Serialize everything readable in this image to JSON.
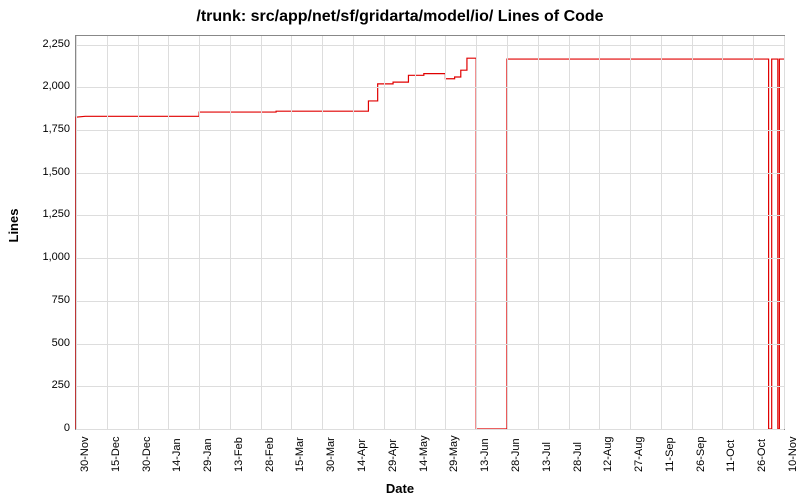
{
  "chart_data": {
    "type": "line",
    "title": "/trunk: src/app/net/sf/gridarta/model/io/ Lines of Code",
    "xlabel": "Date",
    "ylabel": "Lines",
    "ylim": [
      0,
      2300
    ],
    "yticks": [
      0,
      250,
      500,
      750,
      1000,
      1250,
      1500,
      1750,
      2000,
      2250
    ],
    "ytick_labels": [
      "0",
      "250",
      "500",
      "750",
      "1,000",
      "1,250",
      "1,500",
      "1,750",
      "2,000",
      "2,250"
    ],
    "xticks": [
      "30-Nov",
      "15-Dec",
      "30-Dec",
      "14-Jan",
      "29-Jan",
      "13-Feb",
      "28-Feb",
      "15-Mar",
      "30-Mar",
      "14-Apr",
      "29-Apr",
      "14-May",
      "29-May",
      "13-Jun",
      "28-Jun",
      "13-Jul",
      "28-Jul",
      "12-Aug",
      "27-Aug",
      "11-Sep",
      "26-Sep",
      "11-Oct",
      "26-Oct",
      "10-Nov"
    ],
    "x": [
      0,
      1,
      2,
      3,
      4,
      5,
      6,
      7,
      8,
      9,
      10,
      11,
      12,
      13,
      14,
      15,
      16,
      17,
      18,
      19,
      20,
      21,
      22,
      23
    ],
    "series": [
      {
        "name": "Lines of Code",
        "color": "#e00000",
        "points": [
          [
            0.0,
            0
          ],
          [
            0.0,
            1825
          ],
          [
            0.3,
            1830
          ],
          [
            4.0,
            1830
          ],
          [
            4.0,
            1855
          ],
          [
            6.5,
            1855
          ],
          [
            6.5,
            1860
          ],
          [
            9.5,
            1860
          ],
          [
            9.5,
            1920
          ],
          [
            9.8,
            1920
          ],
          [
            9.8,
            2020
          ],
          [
            10.3,
            2020
          ],
          [
            10.3,
            2030
          ],
          [
            10.8,
            2030
          ],
          [
            10.8,
            2070
          ],
          [
            11.3,
            2070
          ],
          [
            11.3,
            2080
          ],
          [
            12.0,
            2080
          ],
          [
            12.0,
            2050
          ],
          [
            12.3,
            2050
          ],
          [
            12.3,
            2060
          ],
          [
            12.5,
            2060
          ],
          [
            12.5,
            2100
          ],
          [
            12.7,
            2100
          ],
          [
            12.7,
            2170
          ],
          [
            13.0,
            2170
          ],
          [
            13.0,
            0
          ],
          [
            14.0,
            0
          ],
          [
            14.0,
            2165
          ],
          [
            22.5,
            2165
          ],
          [
            22.5,
            0
          ],
          [
            22.6,
            0
          ],
          [
            22.6,
            2165
          ],
          [
            22.8,
            2165
          ],
          [
            22.8,
            0
          ],
          [
            22.85,
            0
          ],
          [
            22.85,
            2165
          ],
          [
            23.0,
            2165
          ]
        ]
      }
    ]
  }
}
